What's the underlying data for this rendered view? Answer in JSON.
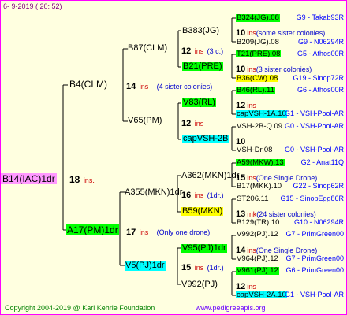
{
  "header": {
    "date": "6-  9-2019 ( 20: 52)"
  },
  "root": {
    "label": "B14(IAC)1dr",
    "count": "18",
    "ins": "ins."
  },
  "gen1": [
    {
      "label": "B4(CLM)",
      "count": "14",
      "ins": "ins",
      "note": "(4 sister colonies)"
    },
    {
      "label": "A17(PM)1dr",
      "count": "17",
      "ins": "ins",
      "note": "(Only one drone)"
    }
  ],
  "gen2": [
    {
      "label": "B87(CLM)",
      "count": "12",
      "ins": "ins",
      "note": "(3 c.)"
    },
    {
      "label": "V65(PM)",
      "count": "12",
      "ins": "ins",
      "note": ""
    },
    {
      "label": "A355(MKN)1dr",
      "count": "16",
      "ins": "ins",
      "note": "(1dr.)"
    },
    {
      "label": "V5(PJ)1dr",
      "count": "15",
      "ins": "ins",
      "note": "(1dr.)"
    }
  ],
  "gen3": [
    {
      "label": "B383(JG)",
      "count": "12",
      "ins": "ins",
      "note": "(3 c.)"
    },
    {
      "label": "B21(PRE)",
      "count": "",
      "ins": "",
      "note": ""
    },
    {
      "label": "V83(RL)",
      "count": "12",
      "ins": "ins",
      "note": ""
    },
    {
      "label": "capVSH-2B",
      "count": "10",
      "ins": "",
      "note": ""
    },
    {
      "label": "A362(MKN)1dr",
      "count": "15",
      "ins": "ins",
      "note": "(One Single Drone)"
    },
    {
      "label": "B59(MKN)",
      "count": "13",
      "ins": "mk",
      "note": "(24 sister colonies)"
    },
    {
      "label": "V95(PJ)1dr",
      "count": "14",
      "ins": "ins",
      "note": "(One Single Drone)"
    },
    {
      "label": "V992(PJ)",
      "count": "12",
      "ins": "ins",
      "note": ""
    }
  ],
  "gen4": [
    {
      "label": "B324(JG).08",
      "tag": "G9 - Takab93R"
    },
    {
      "count": "10",
      "ins": "ins",
      "note": "(some sister colonies)"
    },
    {
      "label": "B209(JG).08",
      "tag": "G9 - N06294R"
    },
    {
      "label": "T21(PRE).08",
      "tag": "G5 - Athos00R"
    },
    {
      "count": "10",
      "ins": "ins",
      "note": "(3 sister colonies)"
    },
    {
      "label": "B36(CW).08",
      "tag": "G19 - Sinop72R"
    },
    {
      "label": "B46(RL).11",
      "tag": "G6 - Athos00R"
    },
    {
      "count": "12",
      "ins": "ins",
      "note": ""
    },
    {
      "label": "capVSH-1A.10",
      "tag": "G1 - VSH-Pool-AR"
    },
    {
      "label": "VSH-2B-Q.09",
      "tag": "G0 - VSH-Pool-AR"
    },
    {
      "count": "10",
      "ins": "",
      "note": ""
    },
    {
      "label": "VSH-Dr.08",
      "tag": "G0 - VSH-Pool-AR"
    },
    {
      "label": "A59(MKW).13",
      "tag": "G2 - Anat11Q"
    },
    {
      "count": "15",
      "ins": "ins",
      "note": "(One Single Drone)"
    },
    {
      "label": "B17(MKK).10",
      "tag": "G22 - Sinop62R"
    },
    {
      "label": "ST206.11",
      "tag": "G15 - SinopEgg86R"
    },
    {
      "count": "13",
      "ins": "mk",
      "note": "(24 sister colonies)"
    },
    {
      "label": "B129(TR).10",
      "tag": "G10 - N06294R"
    },
    {
      "label": "V992(PJ).12",
      "tag": "G7 - PrimGreen00"
    },
    {
      "count": "14",
      "ins": "ins",
      "note": "(One Single Drone)"
    },
    {
      "label": "V964(PJ).12",
      "tag": "G7 - PrimGreen00"
    },
    {
      "label": "V961(PJ).12",
      "tag": "G6 - PrimGreen00"
    },
    {
      "count": "12",
      "ins": "ins",
      "note": ""
    },
    {
      "label": "capVSH-2A.10",
      "tag": "G1 - VSH-Pool-AR"
    }
  ],
  "footer": {
    "copyright": "Copyright 2004-2019 @ Karl Kehrle Foundation",
    "site": "www.pedigreeapis.org"
  }
}
